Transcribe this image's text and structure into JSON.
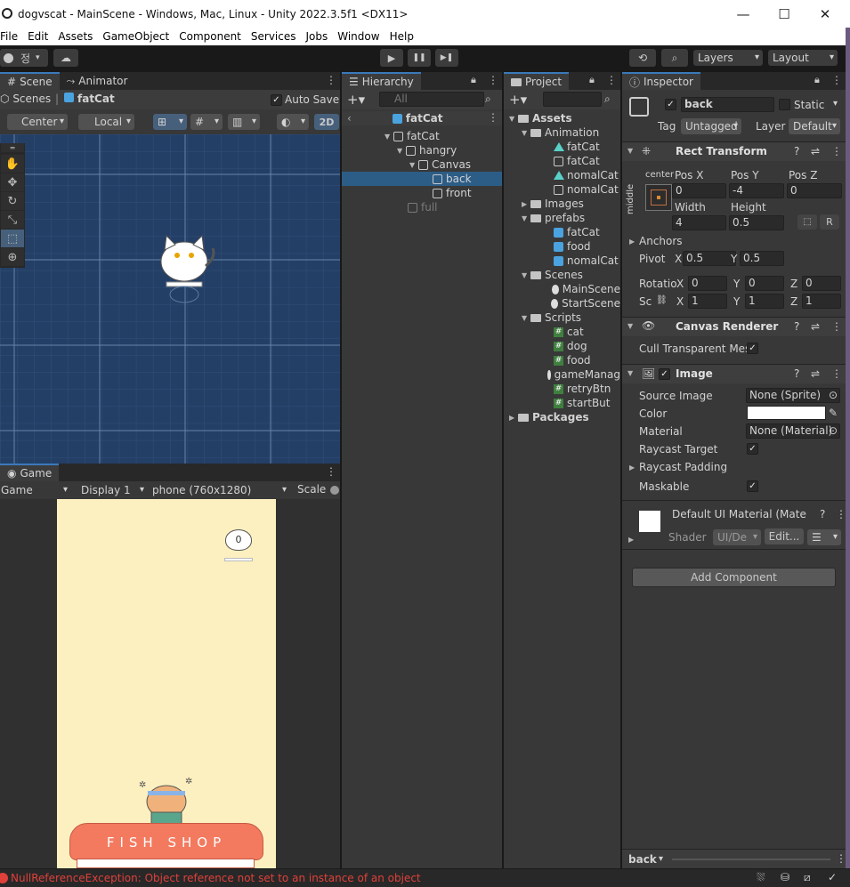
{
  "window": {
    "title": "dogvscat - MainScene - Windows, Mac, Linux - Unity 2022.3.5f1 <DX11>",
    "minimize": "—",
    "maximize": "☐",
    "close": "✕"
  },
  "menu": [
    "File",
    "Edit",
    "Assets",
    "GameObject",
    "Component",
    "Services",
    "Jobs",
    "Window",
    "Help"
  ],
  "toolbar": {
    "account": "정",
    "layers": "Layers",
    "layout": "Layout",
    "play": "▶",
    "pause": "❚❚",
    "step": "▶❚"
  },
  "scene": {
    "tabs": [
      "Scene",
      "Animator"
    ],
    "breadcrumb_root": "Scenes",
    "breadcrumb_sep": "|",
    "breadcrumb_obj": "fatCat",
    "autosave": "Auto Save",
    "pivot": "Center",
    "space": "Local",
    "twod": "2D"
  },
  "game": {
    "tab": "Game",
    "mode": "Game",
    "display": "Display 1",
    "resolution": "phone (760x1280)",
    "scale": "Scale",
    "score": "0",
    "shop_sign": "FISH SHOP"
  },
  "hierarchy": {
    "tab": "Hierarchy",
    "search_placeholder": "All",
    "scene_root": "fatCat",
    "items": [
      {
        "label": "fatCat"
      },
      {
        "label": "hangry"
      },
      {
        "label": "Canvas"
      },
      {
        "label": "back"
      },
      {
        "label": "front"
      },
      {
        "label": "full"
      }
    ]
  },
  "project": {
    "tab": "Project",
    "items": [
      {
        "label": "Assets"
      },
      {
        "label": "Animation"
      },
      {
        "label": "fatCat"
      },
      {
        "label": "fatCat"
      },
      {
        "label": "nomalCat"
      },
      {
        "label": "nomalCat"
      },
      {
        "label": "Images"
      },
      {
        "label": "prefabs"
      },
      {
        "label": "fatCat"
      },
      {
        "label": "food"
      },
      {
        "label": "nomalCat"
      },
      {
        "label": "Scenes"
      },
      {
        "label": "MainScene"
      },
      {
        "label": "StartScene"
      },
      {
        "label": "Scripts"
      },
      {
        "label": "cat"
      },
      {
        "label": "dog"
      },
      {
        "label": "food"
      },
      {
        "label": "gameManag"
      },
      {
        "label": "retryBtn"
      },
      {
        "label": "startBut"
      },
      {
        "label": "Packages"
      }
    ]
  },
  "inspector": {
    "tab": "Inspector",
    "name": "back",
    "static": "Static",
    "tag_label": "Tag",
    "tag": "Untagged",
    "layer_label": "Layer",
    "layer": "Default",
    "rect": {
      "title": "Rect Transform",
      "anchor_h": "center",
      "anchor_v": "middle",
      "posx_label": "Pos X",
      "posy_label": "Pos Y",
      "posz_label": "Pos Z",
      "posx": "0",
      "posy": "-4",
      "posz": "0",
      "width_label": "Width",
      "height_label": "Height",
      "width": "4",
      "height": "0.5",
      "r": "R",
      "anchors": "Anchors",
      "pivot": "Pivot",
      "pivot_x": "0.5",
      "pivot_y": "0.5",
      "rotation": "Rotatio",
      "rot_x": "0",
      "rot_y": "0",
      "rot_z": "0",
      "scale": "Sc",
      "scale_x": "1",
      "scale_y": "1",
      "scale_z": "1",
      "x": "X",
      "y": "Y",
      "z": "Z"
    },
    "canvas_renderer": {
      "title": "Canvas Renderer",
      "cull": "Cull Transparent Mes"
    },
    "image": {
      "title": "Image",
      "source_label": "Source Image",
      "source": "None (Sprite)",
      "color_label": "Color",
      "material_label": "Material",
      "material": "None (Material)",
      "raycast_target": "Raycast Target",
      "raycast_padding": "Raycast Padding",
      "maskable": "Maskable"
    },
    "material": {
      "title": "Default UI Material (Mate",
      "shader_label": "Shader",
      "shader": "UI/De",
      "edit": "Edit..."
    },
    "add_component": "Add Component",
    "footer": "back"
  },
  "console": {
    "error": "NullReferenceException: Object reference not set to an instance of an object"
  },
  "colors": {
    "accent": "#3a79bb",
    "selection": "#2c5d87",
    "error": "#e0403a",
    "game_bg": "#fdf0c0",
    "scene_bg": "#243f66"
  }
}
